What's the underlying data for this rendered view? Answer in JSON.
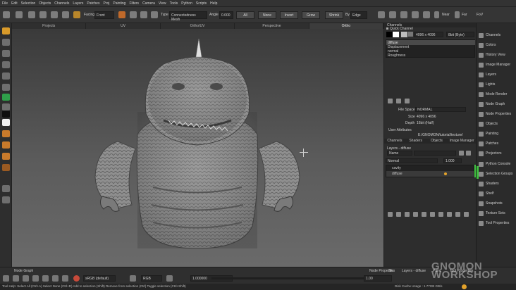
{
  "menu": [
    "File",
    "Edit",
    "Selection",
    "Objects",
    "Channels",
    "Layers",
    "Patches",
    "Proj",
    "Painting",
    "Filters",
    "Camera",
    "View",
    "Tools",
    "Python",
    "Scripts",
    "Help"
  ],
  "toolbar": {
    "facing_label": "Facing",
    "facing_value": "Front",
    "type_label": "Type",
    "type_value": "Connectedness Mesh",
    "angle_label": "Angle",
    "angle_value": "0.000",
    "buttons": [
      "All",
      "None",
      "Invert",
      "Grow",
      "Shrink"
    ],
    "by_label": "By",
    "by_value": "Edge",
    "near_label": "Near",
    "far_label": "Far",
    "fov_label": "FoV"
  },
  "view_tabs": [
    "Projects",
    "UV",
    "Ortho/UV",
    "Perspective",
    "Ortho"
  ],
  "active_view_tab": "Ortho",
  "channels_panel": {
    "title": "Channels",
    "quick_channel_label": "Quick Channel",
    "size_value": "4096 x 4096",
    "depth_value": "8bit (Byte)",
    "channels": [
      "diffuse",
      "Displacement",
      "normal",
      "Roughness"
    ],
    "selected_channel": "diffuse",
    "file_space_label": "File Space",
    "file_space_value": "NORMAL",
    "size_label": "Size",
    "size_info": "4096 x 4096",
    "depth_label": "Depth",
    "depth_info": "16bit (Half)",
    "user_attributes_label": "User Attributes",
    "path_value": "E:/GNOMON/tutorial/texture/"
  },
  "mid_tabs": [
    "Channels",
    "Shaders",
    "Objects",
    "Image Manager"
  ],
  "layers_panel": {
    "title": "Layers - diffuse",
    "name_label": "Name",
    "blend_value": "Normal",
    "opacity_value": "1.000",
    "layers": [
      {
        "name": "cavity",
        "selected": false
      },
      {
        "name": "diffuse",
        "selected": true
      }
    ]
  },
  "sidebar": [
    "Channels",
    "Colors",
    "History View",
    "Image Manager",
    "Layers",
    "Lights",
    "Mode Render",
    "Node Graph",
    "Node Properties",
    "Objects",
    "Painting",
    "Patches",
    "Projectors",
    "Python Console",
    "Selection Groups",
    "Shaders",
    "Shelf",
    "Snapshots",
    "Texture Sets",
    "Tool Properties"
  ],
  "bottom": {
    "left_tab": "Node Graph",
    "mid_tab": "Node Properties",
    "right_tabs": [
      "Sh.",
      "Layers - diffuse",
      "Paint",
      "Tool Properties"
    ],
    "colorspace_value": "sRGB (default)",
    "channel_value": "RGB",
    "gain_value": "1.000000",
    "gamma_value": "1.00"
  },
  "status": {
    "left": "Tool Help: Select All (Ctrl+A)   Select None (Ctrl+D)   Add to selection (Shift)   Remove from selection (Ctrl)   Toggle selection (Ctrl+Shift)",
    "right": "Disk Cache Usage : 1.77GB  GB/s"
  },
  "watermark": "GNOMON WORKSHOP",
  "colors": {
    "accent": "#e3a22b",
    "green": "#3fbf3f",
    "panel": "#2d2d2d"
  }
}
